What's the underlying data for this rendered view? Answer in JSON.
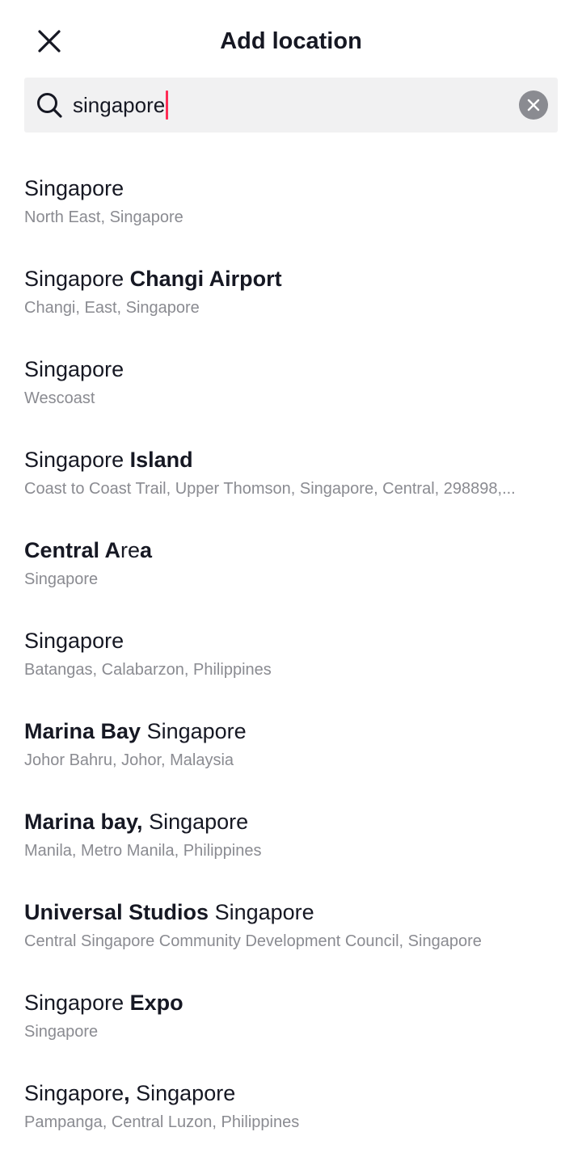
{
  "header": {
    "title": "Add location",
    "close_icon": "close-icon"
  },
  "search": {
    "value": "singapore",
    "search_icon": "search-icon",
    "clear_icon": "clear-circle-icon",
    "caret_color": "#fe2c55"
  },
  "results": [
    {
      "segments": [
        {
          "text": "Singapore",
          "bold": false
        }
      ],
      "subtitle": "North East, Singapore"
    },
    {
      "segments": [
        {
          "text": "Singapore ",
          "bold": false
        },
        {
          "text": "Changi Airport",
          "bold": true
        }
      ],
      "subtitle": "Changi, East, Singapore"
    },
    {
      "segments": [
        {
          "text": "Singapore",
          "bold": false
        }
      ],
      "subtitle": "Wescoast"
    },
    {
      "segments": [
        {
          "text": "Singapore ",
          "bold": false
        },
        {
          "text": "Island",
          "bold": true
        }
      ],
      "subtitle": "Coast to Coast Trail, Upper Thomson, Singapore, Central, 298898,..."
    },
    {
      "segments": [
        {
          "text": "Central A",
          "bold": true
        },
        {
          "text": "re",
          "bold": false
        },
        {
          "text": "a",
          "bold": true
        }
      ],
      "subtitle": "Singapore"
    },
    {
      "segments": [
        {
          "text": "Singapore",
          "bold": false
        }
      ],
      "subtitle": "Batangas, Calabarzon, Philippines"
    },
    {
      "segments": [
        {
          "text": "Marina Bay",
          "bold": true
        },
        {
          "text": " Singapore",
          "bold": false
        }
      ],
      "subtitle": "Johor Bahru, Johor, Malaysia"
    },
    {
      "segments": [
        {
          "text": "Marina bay,",
          "bold": true
        },
        {
          "text": " Singapore",
          "bold": false
        }
      ],
      "subtitle": "Manila, Metro Manila, Philippines"
    },
    {
      "segments": [
        {
          "text": "Universal Studios",
          "bold": true
        },
        {
          "text": " Singapore",
          "bold": false
        }
      ],
      "subtitle": "Central Singapore Community Development Council, Singapore"
    },
    {
      "segments": [
        {
          "text": "Singapore ",
          "bold": false
        },
        {
          "text": "Expo",
          "bold": true
        }
      ],
      "subtitle": "Singapore"
    },
    {
      "segments": [
        {
          "text": "Singapore",
          "bold": false
        },
        {
          "text": ",",
          "bold": true
        },
        {
          "text": " Singapore",
          "bold": false
        }
      ],
      "subtitle": "Pampanga, Central Luzon, Philippines"
    }
  ],
  "colors": {
    "text_primary": "#161823",
    "text_secondary": "#8a8b91",
    "search_bg": "#f1f1f2",
    "accent": "#fe2c55"
  }
}
